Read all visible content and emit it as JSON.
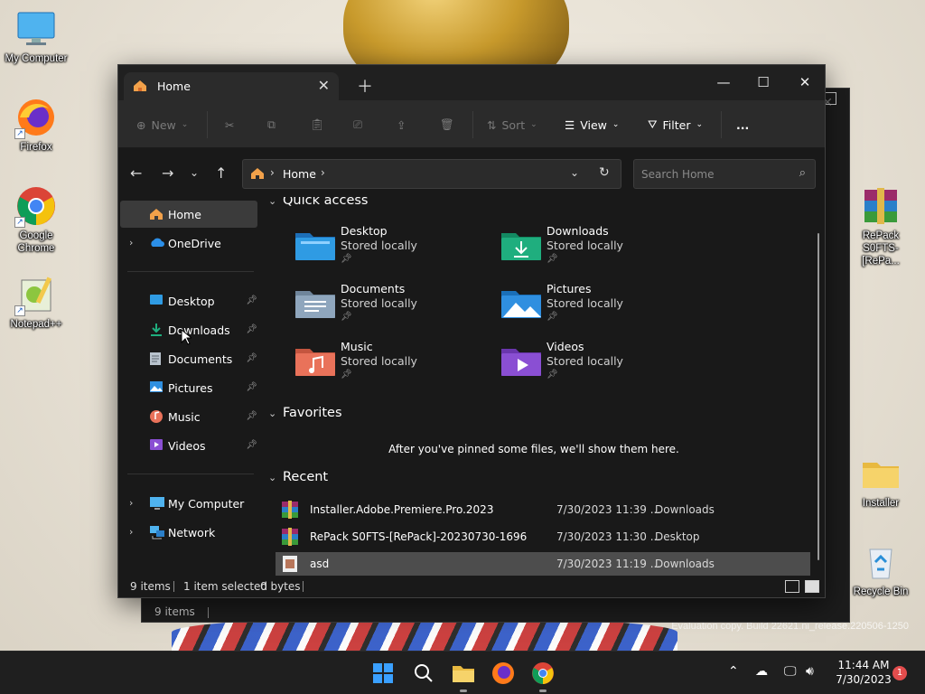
{
  "desktop": {
    "icons": [
      {
        "label": "My Computer"
      },
      {
        "label": "Firefox"
      },
      {
        "label": "Google Chrome"
      },
      {
        "label": "Notepad++"
      },
      {
        "label": "RePack S0FTS-[RePa..."
      },
      {
        "label": "Installer"
      },
      {
        "label": "Recycle Bin"
      }
    ],
    "watermark": [
      "Evaluation copy. Build 22621.ni_release.220506-1250"
    ]
  },
  "back_window": {
    "status_items": "9 items"
  },
  "window": {
    "tab_title": "Home",
    "toolbar": {
      "new_label": "New",
      "sort_label": "Sort",
      "view_label": "View",
      "filter_label": "Filter",
      "more_label": "..."
    },
    "address": {
      "crumb": "Home"
    },
    "search": {
      "placeholder": "Search Home"
    },
    "sidebar": {
      "home": "Home",
      "onedrive": "OneDrive",
      "pinned": [
        {
          "label": "Desktop",
          "icon": "desktop-folder-icon"
        },
        {
          "label": "Downloads",
          "icon": "downloads-folder-icon"
        },
        {
          "label": "Documents",
          "icon": "documents-folder-icon"
        },
        {
          "label": "Pictures",
          "icon": "pictures-folder-icon"
        },
        {
          "label": "Music",
          "icon": "music-folder-icon"
        },
        {
          "label": "Videos",
          "icon": "videos-folder-icon"
        }
      ],
      "my_computer": "My Computer",
      "network": "Network"
    },
    "quick_access": {
      "header": "Quick access",
      "items": [
        {
          "name": "Desktop",
          "sub": "Stored locally",
          "color": "#2f9be3"
        },
        {
          "name": "Downloads",
          "sub": "Stored locally",
          "color": "#1fae7e"
        },
        {
          "name": "Documents",
          "sub": "Stored locally",
          "color": "#8fa6bd"
        },
        {
          "name": "Pictures",
          "sub": "Stored locally",
          "color": "#2f8fe0"
        },
        {
          "name": "Music",
          "sub": "Stored locally",
          "color": "#e9725a"
        },
        {
          "name": "Videos",
          "sub": "Stored locally",
          "color": "#8a4fd3"
        }
      ]
    },
    "favorites": {
      "header": "Favorites",
      "empty_text": "After you've pinned some files, we'll show them here."
    },
    "recent": {
      "header": "Recent",
      "rows": [
        {
          "name": "Installer.Adobe.Premiere.Pro.2023",
          "date": "7/30/2023 11:39 ...",
          "location": "Downloads"
        },
        {
          "name": "RePack S0FTS-[RePack]-20230730-1696",
          "date": "7/30/2023 11:30 ...",
          "location": "Desktop"
        },
        {
          "name": "asd",
          "date": "7/30/2023 11:19 ...",
          "location": "Downloads"
        }
      ]
    },
    "status": {
      "items": "9 items",
      "selected": "1 item selected",
      "size": "0 bytes"
    }
  },
  "taskbar": {
    "time": "11:44 AM",
    "date": "7/30/2023",
    "notification_count": "1"
  }
}
